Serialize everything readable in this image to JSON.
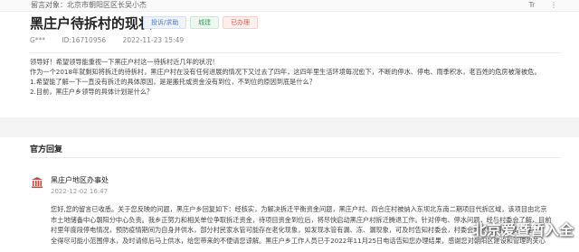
{
  "header": {
    "target_prefix": "留言对象：",
    "target": "北京市朝阳区区长吴小杰",
    "title": "黑庄户待拆村的现状",
    "tags": {
      "type": "投诉/求助",
      "domain": "城建",
      "status": "已办理"
    },
    "author": "G***",
    "id": "ID:16710956",
    "datetime": "2022-11-23 15:49"
  },
  "message": {
    "lines": [
      "领导好！希望领导能重视一下黑庄户村这一待拆村近几年的状况！",
      "作为一个2018年就剩知将拆迁的待拆村，黑庄户村在没有任何进展的情况下又过去了四年，这四年里生活环境每况愈下，不断的停水、停电、雨季积水，老百姓的危房被渐被危。",
      "1.希望能了解一下一直没有拆迁的具体原因，是是搬托或资金没有到位，不到位的原因到底是什么？",
      "2.目前，黑庄户乡领导的具体计划是什么？"
    ]
  },
  "reply": {
    "section_title": "官方回复",
    "org_name": "黑庄户地区办事处",
    "date": "2022-12-02 16:47",
    "lines": [
      "您好,您的留言已收悉。关于您反映的问题，黑庄户乡回复如下：经核实，为解决拆迁平衡资金问题，黑庄户村、四合庄村被纳入东坝北东南二期项目代拆区域，该项目由北京",
      "市土地储备中心朝阳分中心负责。我乡正努力和相关单位争取拆迁资金，待项目资金到位后，将尽快启动黑庄户村拆迁腾退工作。针对停电、停水问题，经与村委会了解，目前",
      "村里年度段停电情况，预防疫情期间为自身并供水，部分村民家水管可能存在老化现象，如发现水管有漏、冻、漏现象，可及时告知村委会，村委会将尽快安排人员修理。",
      "全得尽可能小范围停水，及时请修后马上供水，给您带来的不便请您谅解。黑庄户乡工作人员已于2022年11月25日电话告知您办理结果，感谢您对朝阳区建设和管理的关心"
    ]
  },
  "top_icons": [
    "Tr"
  ],
  "watermark": "北京爱暨暂入全"
}
